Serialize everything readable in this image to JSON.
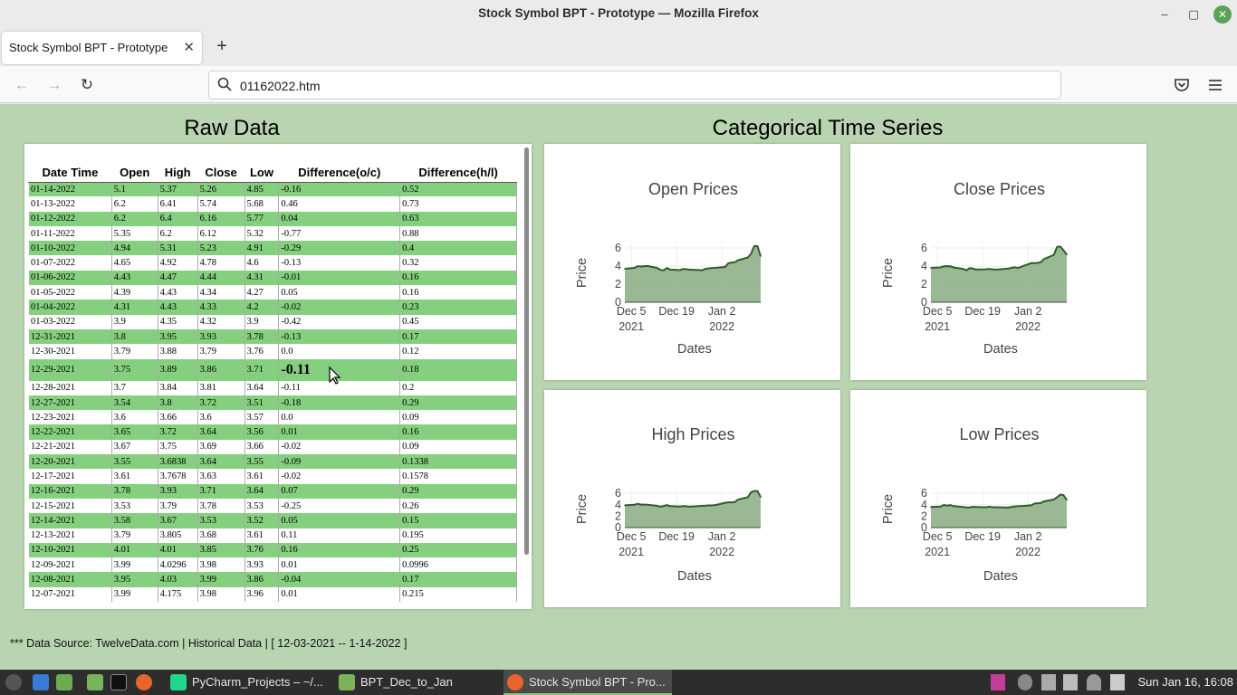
{
  "window": {
    "title": "Stock Symbol BPT - Prototype — Mozilla Firefox",
    "minimize": "–",
    "maximize": "▢",
    "close": "✕"
  },
  "tab": {
    "title": "Stock Symbol BPT - Prototype",
    "close": "✕",
    "new_tab": "+"
  },
  "nav": {
    "back": "←",
    "forward": "→",
    "reload": "↻",
    "url": "01162022.htm"
  },
  "page": {
    "raw_heading": "Raw Data",
    "charts_heading": "Categorical Time Series",
    "footer": "*** Data Source: TwelveData.com | Historical Data | [ 12-03-2021 -- 1-14-2022 ]"
  },
  "table": {
    "headers": [
      "Date Time",
      "Open",
      "High",
      "Close",
      "Low",
      "Difference(o/c)",
      "Difference(h/l)"
    ],
    "rows": [
      [
        "01-14-2022",
        "5.1",
        "5.37",
        "5.26",
        "4.85",
        "-0.16",
        "0.52"
      ],
      [
        "01-13-2022",
        "6.2",
        "6.41",
        "5.74",
        "5.68",
        "0.46",
        "0.73"
      ],
      [
        "01-12-2022",
        "6.2",
        "6.4",
        "6.16",
        "5.77",
        "0.04",
        "0.63"
      ],
      [
        "01-11-2022",
        "5.35",
        "6.2",
        "6.12",
        "5.32",
        "-0.77",
        "0.88"
      ],
      [
        "01-10-2022",
        "4.94",
        "5.31",
        "5.23",
        "4.91",
        "-0.29",
        "0.4"
      ],
      [
        "01-07-2022",
        "4.65",
        "4.92",
        "4.78",
        "4.6",
        "-0.13",
        "0.32"
      ],
      [
        "01-06-2022",
        "4.43",
        "4.47",
        "4.44",
        "4.31",
        "-0.01",
        "0.16"
      ],
      [
        "01-05-2022",
        "4.39",
        "4.43",
        "4.34",
        "4.27",
        "0.05",
        "0.16"
      ],
      [
        "01-04-2022",
        "4.31",
        "4.43",
        "4.33",
        "4.2",
        "-0.02",
        "0.23"
      ],
      [
        "01-03-2022",
        "3.9",
        "4.35",
        "4.32",
        "3.9",
        "-0.42",
        "0.45"
      ],
      [
        "12-31-2021",
        "3.8",
        "3.95",
        "3.93",
        "3.78",
        "-0.13",
        "0.17"
      ],
      [
        "12-30-2021",
        "3.79",
        "3.88",
        "3.79",
        "3.76",
        "0.0",
        "0.12"
      ],
      [
        "12-29-2021",
        "3.75",
        "3.89",
        "3.86",
        "3.71",
        "-0.11",
        "0.18"
      ],
      [
        "12-28-2021",
        "3.7",
        "3.84",
        "3.81",
        "3.64",
        "-0.11",
        "0.2"
      ],
      [
        "12-27-2021",
        "3.54",
        "3.8",
        "3.72",
        "3.51",
        "-0.18",
        "0.29"
      ],
      [
        "12-23-2021",
        "3.6",
        "3.66",
        "3.6",
        "3.57",
        "0.0",
        "0.09"
      ],
      [
        "12-22-2021",
        "3.65",
        "3.72",
        "3.64",
        "3.56",
        "0.01",
        "0.16"
      ],
      [
        "12-21-2021",
        "3.67",
        "3.75",
        "3.69",
        "3.66",
        "-0.02",
        "0.09"
      ],
      [
        "12-20-2021",
        "3.55",
        "3.6838",
        "3.64",
        "3.55",
        "-0.09",
        "0.1338"
      ],
      [
        "12-17-2021",
        "3.61",
        "3.7678",
        "3.63",
        "3.61",
        "-0.02",
        "0.1578"
      ],
      [
        "12-16-2021",
        "3.78",
        "3.93",
        "3.71",
        "3.64",
        "0.07",
        "0.29"
      ],
      [
        "12-15-2021",
        "3.53",
        "3.79",
        "3.78",
        "3.53",
        "-0.25",
        "0.26"
      ],
      [
        "12-14-2021",
        "3.58",
        "3.67",
        "3.53",
        "3.52",
        "0.05",
        "0.15"
      ],
      [
        "12-13-2021",
        "3.79",
        "3.805",
        "3.68",
        "3.61",
        "0.11",
        "0.195"
      ],
      [
        "12-10-2021",
        "4.01",
        "4.01",
        "3.85",
        "3.76",
        "0.16",
        "0.25"
      ],
      [
        "12-09-2021",
        "3.99",
        "4.0296",
        "3.98",
        "3.93",
        "0.01",
        "0.0996"
      ],
      [
        "12-08-2021",
        "3.95",
        "4.03",
        "3.99",
        "3.86",
        "-0.04",
        "0.17"
      ],
      [
        "12-07-2021",
        "3.99",
        "4.175",
        "3.98",
        "3.96",
        "0.01",
        "0.215"
      ]
    ],
    "hovered_row": 12
  },
  "chart_data": [
    {
      "type": "area",
      "title": "Open Prices",
      "xlabel": "Dates",
      "ylabel": "Price",
      "yticks": [
        "0",
        "2",
        "4",
        "6"
      ],
      "ylim": [
        0,
        6.5
      ],
      "xticks": [
        {
          "label": "Dec 5",
          "sub": "2021"
        },
        {
          "label": "Dec 19",
          "sub": ""
        },
        {
          "label": "Jan 2",
          "sub": "2022"
        }
      ],
      "x": [
        "2021-12-03",
        "2021-12-06",
        "2021-12-07",
        "2021-12-08",
        "2021-12-09",
        "2021-12-10",
        "2021-12-13",
        "2021-12-14",
        "2021-12-15",
        "2021-12-16",
        "2021-12-17",
        "2021-12-20",
        "2021-12-21",
        "2021-12-22",
        "2021-12-23",
        "2021-12-27",
        "2021-12-28",
        "2021-12-29",
        "2021-12-30",
        "2021-12-31",
        "2022-01-03",
        "2022-01-04",
        "2022-01-05",
        "2022-01-06",
        "2022-01-07",
        "2022-01-10",
        "2022-01-11",
        "2022-01-12",
        "2022-01-13",
        "2022-01-14"
      ],
      "values": [
        3.7,
        3.8,
        3.99,
        3.95,
        3.99,
        4.01,
        3.79,
        3.58,
        3.53,
        3.78,
        3.61,
        3.55,
        3.67,
        3.65,
        3.6,
        3.54,
        3.7,
        3.75,
        3.79,
        3.8,
        3.9,
        4.31,
        4.39,
        4.43,
        4.65,
        4.94,
        5.35,
        6.2,
        6.2,
        5.1
      ]
    },
    {
      "type": "area",
      "title": "Close Prices",
      "xlabel": "Dates",
      "ylabel": "Price",
      "yticks": [
        "0",
        "2",
        "4",
        "6"
      ],
      "ylim": [
        0,
        6.5
      ],
      "xticks": [
        {
          "label": "Dec 5",
          "sub": "2021"
        },
        {
          "label": "Dec 19",
          "sub": ""
        },
        {
          "label": "Jan 2",
          "sub": "2022"
        }
      ],
      "x": [
        "2021-12-03",
        "2021-12-06",
        "2021-12-07",
        "2021-12-08",
        "2021-12-09",
        "2021-12-10",
        "2021-12-13",
        "2021-12-14",
        "2021-12-15",
        "2021-12-16",
        "2021-12-17",
        "2021-12-20",
        "2021-12-21",
        "2021-12-22",
        "2021-12-23",
        "2021-12-27",
        "2021-12-28",
        "2021-12-29",
        "2021-12-30",
        "2021-12-31",
        "2022-01-03",
        "2022-01-04",
        "2022-01-05",
        "2022-01-06",
        "2022-01-07",
        "2022-01-10",
        "2022-01-11",
        "2022-01-12",
        "2022-01-13",
        "2022-01-14"
      ],
      "values": [
        3.8,
        3.85,
        3.98,
        3.99,
        3.98,
        3.85,
        3.68,
        3.53,
        3.78,
        3.71,
        3.63,
        3.64,
        3.69,
        3.64,
        3.6,
        3.72,
        3.81,
        3.86,
        3.79,
        3.93,
        4.32,
        4.33,
        4.34,
        4.44,
        4.78,
        5.23,
        6.12,
        6.16,
        5.74,
        5.26
      ]
    },
    {
      "type": "area",
      "title": "High Prices",
      "xlabel": "Dates",
      "ylabel": "Price",
      "yticks": [
        "0",
        "2",
        "4",
        "6"
      ],
      "ylim": [
        0,
        6.5
      ],
      "xticks": [
        {
          "label": "Dec 5",
          "sub": "2021"
        },
        {
          "label": "Dec 19",
          "sub": ""
        },
        {
          "label": "Jan 2",
          "sub": "2022"
        }
      ],
      "x": [
        "2021-12-03",
        "2021-12-06",
        "2021-12-07",
        "2021-12-08",
        "2021-12-09",
        "2021-12-10",
        "2021-12-13",
        "2021-12-14",
        "2021-12-15",
        "2021-12-16",
        "2021-12-17",
        "2021-12-20",
        "2021-12-21",
        "2021-12-22",
        "2021-12-23",
        "2021-12-27",
        "2021-12-28",
        "2021-12-29",
        "2021-12-30",
        "2021-12-31",
        "2022-01-03",
        "2022-01-04",
        "2022-01-05",
        "2022-01-06",
        "2022-01-07",
        "2022-01-10",
        "2022-01-11",
        "2022-01-12",
        "2022-01-13",
        "2022-01-14"
      ],
      "values": [
        3.9,
        4.0,
        4.175,
        4.03,
        4.0296,
        4.01,
        3.805,
        3.67,
        3.79,
        3.93,
        3.7678,
        3.6838,
        3.75,
        3.72,
        3.66,
        3.8,
        3.84,
        3.89,
        3.88,
        3.95,
        4.35,
        4.43,
        4.43,
        4.47,
        4.92,
        5.31,
        6.2,
        6.4,
        6.41,
        5.37
      ]
    },
    {
      "type": "area",
      "title": "Low Prices",
      "xlabel": "Dates",
      "ylabel": "Price",
      "yticks": [
        "0",
        "2",
        "4",
        "6"
      ],
      "ylim": [
        0,
        6.5
      ],
      "xticks": [
        {
          "label": "Dec 5",
          "sub": "2021"
        },
        {
          "label": "Dec 19",
          "sub": ""
        },
        {
          "label": "Jan 2",
          "sub": "2022"
        }
      ],
      "x": [
        "2021-12-03",
        "2021-12-06",
        "2021-12-07",
        "2021-12-08",
        "2021-12-09",
        "2021-12-10",
        "2021-12-13",
        "2021-12-14",
        "2021-12-15",
        "2021-12-16",
        "2021-12-17",
        "2021-12-20",
        "2021-12-21",
        "2021-12-22",
        "2021-12-23",
        "2021-12-27",
        "2021-12-28",
        "2021-12-29",
        "2021-12-30",
        "2021-12-31",
        "2022-01-03",
        "2022-01-04",
        "2022-01-05",
        "2022-01-06",
        "2022-01-07",
        "2022-01-10",
        "2022-01-11",
        "2022-01-12",
        "2022-01-13",
        "2022-01-14"
      ],
      "values": [
        3.6,
        3.7,
        3.96,
        3.86,
        3.93,
        3.76,
        3.61,
        3.52,
        3.53,
        3.64,
        3.61,
        3.55,
        3.66,
        3.56,
        3.57,
        3.51,
        3.64,
        3.71,
        3.76,
        3.78,
        3.9,
        4.2,
        4.27,
        4.31,
        4.6,
        4.91,
        5.32,
        5.77,
        5.68,
        4.85
      ]
    }
  ],
  "taskbar": {
    "items": [
      "PyCharm_Projects – ~/...",
      "BPT_Dec_to_Jan",
      "Stock Symbol BPT - Pro..."
    ],
    "clock": "Sun Jan 16, 16:08"
  },
  "colors": {
    "page_bg": "#b9d4b0",
    "row_green": "#85d07e",
    "area_fill": "#8aab83",
    "area_line": "#2e5e28"
  }
}
